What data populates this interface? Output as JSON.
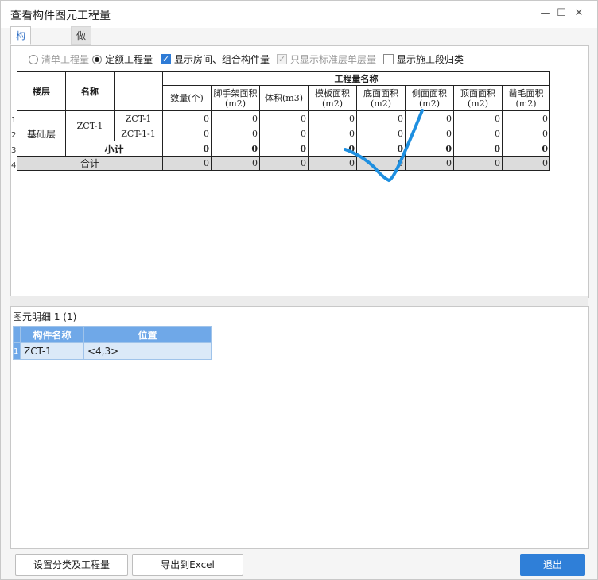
{
  "window": {
    "title": "查看构件图元工程量",
    "tabs": [
      "构件工程量",
      "做法工程量"
    ]
  },
  "options": {
    "radio_list": "清单工程量",
    "radio_quota": "定额工程量",
    "chk_show_rooms": "显示房间、组合构件量",
    "chk_std_floor": "只显示标准层单层量",
    "chk_show_segment": "显示施工段归类"
  },
  "table": {
    "col_floor": "楼层",
    "col_name": "名称",
    "group_header": "工程量名称",
    "metric_headers": [
      "数量(个)",
      "脚手架面积(m2)",
      "体积(m3)",
      "模板面积(m2)",
      "底面面积(m2)",
      "侧面面积(m2)",
      "顶面面积(m2)",
      "凿毛面积(m2)"
    ],
    "row_numbers": [
      "1",
      "2",
      "3",
      "4"
    ],
    "floor_value": "基础层",
    "name_value": "ZCT-1",
    "rows": [
      {
        "sub": "ZCT-1",
        "values": [
          "0",
          "0",
          "0",
          "0",
          "0",
          "0",
          "0",
          "0"
        ]
      },
      {
        "sub": "ZCT-1-1",
        "values": [
          "0",
          "0",
          "0",
          "0",
          "0",
          "0",
          "0",
          "0"
        ]
      }
    ],
    "subtotal_label": "小计",
    "subtotal_values": [
      "0",
      "0",
      "0",
      "0",
      "0",
      "0",
      "0",
      "0"
    ],
    "total_label": "合计",
    "total_values": [
      "0",
      "0",
      "0",
      "0",
      "0",
      "0",
      "0",
      "0"
    ]
  },
  "detail": {
    "title": "图元明细  1 (1)",
    "col_component": "构件名称",
    "col_position": "位置",
    "row_number": "1",
    "row_component": "ZCT-1",
    "row_position": "<4,3>"
  },
  "buttons": {
    "set_category": "设置分类及工程量",
    "export_excel": "导出到Excel",
    "exit": "退出"
  },
  "colors": {
    "accent": "#2f7fd8",
    "annotation": "#1e8fe0"
  }
}
